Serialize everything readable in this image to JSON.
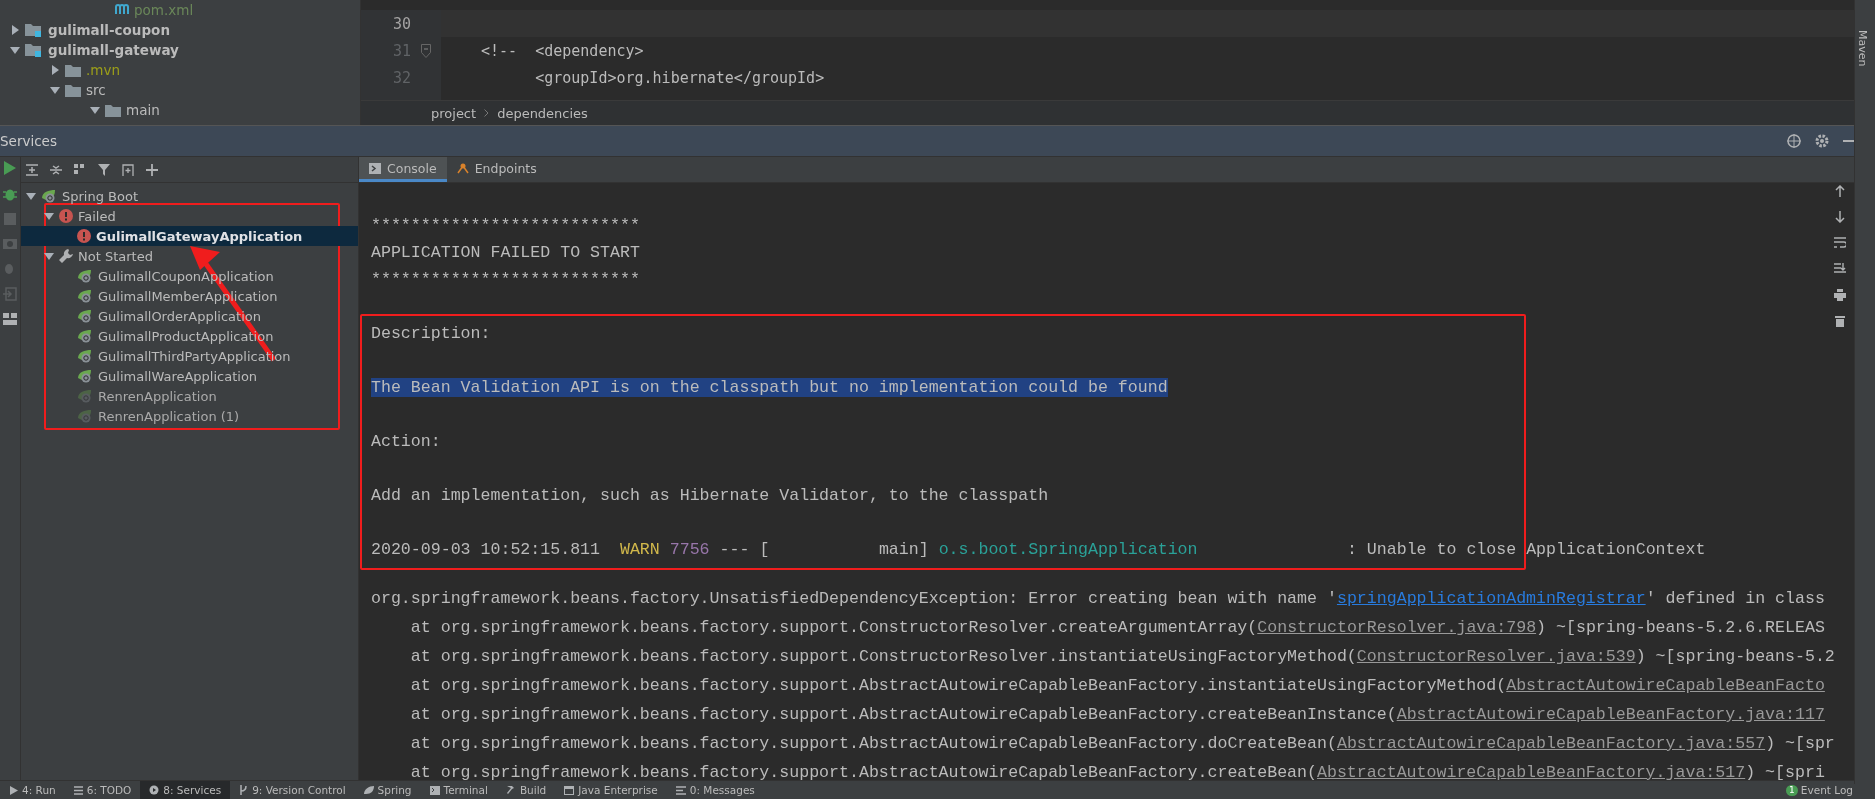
{
  "project_tree": {
    "items": [
      {
        "label": "pom.xml",
        "kind": "maven-file"
      },
      {
        "label": "gulimall-coupon",
        "kind": "module",
        "expanded": false
      },
      {
        "label": "gulimall-gateway",
        "kind": "module",
        "expanded": true,
        "children": [
          {
            "label": ".mvn",
            "kind": "folder",
            "expanded": false,
            "excluded": true
          },
          {
            "label": "src",
            "kind": "folder",
            "expanded": true,
            "excluded": false,
            "children": [
              {
                "label": "main",
                "kind": "folder",
                "expanded": true,
                "excluded": false
              }
            ]
          }
        ]
      }
    ]
  },
  "editor": {
    "lines": [
      {
        "number": "30",
        "current": true
      },
      {
        "number": "31",
        "current": false,
        "fold": true,
        "text": "<!--  <dependency>"
      },
      {
        "number": "32",
        "current": false,
        "text": "      <groupId>org.hibernate</groupId>"
      }
    ],
    "breadcrumbs": [
      "project",
      "dependencies"
    ]
  },
  "services": {
    "title": "Services",
    "tree": [
      {
        "label": "Spring Boot",
        "kind": "spring",
        "expanded": true,
        "selected": false,
        "children": [
          {
            "label": "Failed",
            "kind": "error",
            "expanded": true,
            "selected": false,
            "children": [
              {
                "label": "GulimallGatewayApplication",
                "kind": "error",
                "selected": true
              }
            ]
          },
          {
            "label": "Not Started",
            "kind": "wrench",
            "expanded": true,
            "selected": false,
            "children": [
              {
                "label": "GulimallCouponApplication",
                "kind": "app",
                "disabled": false,
                "selected": false
              },
              {
                "label": "GulimallMemberApplication",
                "kind": "app",
                "disabled": false,
                "selected": false
              },
              {
                "label": "GulimallOrderApplication",
                "kind": "app",
                "disabled": false,
                "selected": false
              },
              {
                "label": "GulimallProductApplication",
                "kind": "app",
                "disabled": false,
                "selected": false
              },
              {
                "label": "GulimallThirdPartyApplication",
                "kind": "app",
                "disabled": false,
                "selected": false
              },
              {
                "label": "GulimallWareApplication",
                "kind": "app",
                "disabled": false,
                "selected": false
              },
              {
                "label": "RenrenApplication",
                "kind": "app",
                "disabled": true,
                "selected": false
              },
              {
                "label": "RenrenApplication (1)",
                "kind": "app",
                "disabled": true,
                "selected": false
              }
            ]
          }
        ]
      }
    ],
    "tabs": [
      {
        "label": "Console",
        "selected": true
      },
      {
        "label": "Endpoints",
        "selected": false
      }
    ],
    "console": [
      {
        "kind": "text",
        "spans": [
          {
            "kind": "plain",
            "text": "***************************"
          }
        ]
      },
      {
        "kind": "text",
        "spans": [
          {
            "kind": "plain",
            "text": "APPLICATION FAILED TO START"
          }
        ]
      },
      {
        "kind": "text",
        "spans": [
          {
            "kind": "plain",
            "text": "***************************"
          }
        ]
      },
      {
        "kind": "blank"
      },
      {
        "kind": "text",
        "spans": [
          {
            "kind": "plain",
            "text": "Description:"
          }
        ]
      },
      {
        "kind": "blank"
      },
      {
        "kind": "text",
        "spans": [
          {
            "kind": "selected",
            "text": "The Bean Validation API is on the classpath but no implementation could be found"
          }
        ]
      },
      {
        "kind": "blank"
      },
      {
        "kind": "text",
        "spans": [
          {
            "kind": "plain",
            "text": "Action:"
          }
        ]
      },
      {
        "kind": "blank"
      },
      {
        "kind": "text",
        "spans": [
          {
            "kind": "plain",
            "text": "Add an implementation, such as Hibernate Validator, to the classpath"
          }
        ]
      },
      {
        "kind": "blank"
      },
      {
        "kind": "text",
        "spans": [
          {
            "kind": "plain",
            "text": "2020-09-03 10:52:15.811  "
          },
          {
            "kind": "warn",
            "text": "WARN"
          },
          {
            "kind": "pid",
            "text": "7756"
          },
          {
            "kind": "plain",
            "text": " --- [           main] "
          },
          {
            "kind": "logger",
            "text": "o.s.boot.SpringApplication"
          },
          {
            "kind": "plain",
            "text": "               : Unable to close ApplicationContext"
          }
        ]
      }
    ],
    "stack": [
      {
        "spans": [
          {
            "kind": "plain",
            "text": "org.springframework.beans.factory.UnsatisfiedDependencyException: Error creating bean with name '"
          },
          {
            "kind": "link",
            "text": "springApplicationAdminRegistrar"
          },
          {
            "kind": "plain",
            "text": "' defined in class"
          }
        ]
      },
      {
        "spans": [
          {
            "kind": "plain",
            "text": "    at org.springframework.beans.factory.support.ConstructorResolver.createArgumentArray("
          },
          {
            "kind": "file",
            "text": "ConstructorResolver.java:798"
          },
          {
            "kind": "plain",
            "text": ") ~[spring-beans-5.2.6.RELEAS"
          }
        ]
      },
      {
        "spans": [
          {
            "kind": "plain",
            "text": "    at org.springframework.beans.factory.support.ConstructorResolver.instantiateUsingFactoryMethod("
          },
          {
            "kind": "file",
            "text": "ConstructorResolver.java:539"
          },
          {
            "kind": "plain",
            "text": ") ~[spring-beans-5.2"
          }
        ]
      },
      {
        "spans": [
          {
            "kind": "plain",
            "text": "    at org.springframework.beans.factory.support.AbstractAutowireCapableBeanFactory.instantiateUsingFactoryMethod("
          },
          {
            "kind": "file",
            "text": "AbstractAutowireCapableBeanFacto"
          }
        ]
      },
      {
        "spans": [
          {
            "kind": "plain",
            "text": "    at org.springframework.beans.factory.support.AbstractAutowireCapableBeanFactory.createBeanInstance("
          },
          {
            "kind": "file",
            "text": "AbstractAutowireCapableBeanFactory.java:117"
          }
        ]
      },
      {
        "spans": [
          {
            "kind": "plain",
            "text": "    at org.springframework.beans.factory.support.AbstractAutowireCapableBeanFactory.doCreateBean("
          },
          {
            "kind": "file",
            "text": "AbstractAutowireCapableBeanFactory.java:557"
          },
          {
            "kind": "plain",
            "text": ") ~[spr"
          }
        ]
      },
      {
        "spans": [
          {
            "kind": "plain",
            "text": "    at org.springframework.beans.factory.support.AbstractAutowireCapableBeanFactory.createBean("
          },
          {
            "kind": "file",
            "text": "AbstractAutowireCapableBeanFactory.java:517"
          },
          {
            "kind": "plain",
            "text": ") ~[spri"
          }
        ]
      }
    ]
  },
  "right_strip": [
    "Maven"
  ],
  "bottom_bar": {
    "tabs": [
      {
        "label": "4: Run",
        "kind": "run",
        "selected": false
      },
      {
        "label": "6: TODO",
        "kind": "todo",
        "selected": false
      },
      {
        "label": "8: Services",
        "kind": "services",
        "selected": true
      },
      {
        "label": "9: Version Control",
        "kind": "vcs",
        "selected": false
      },
      {
        "label": "Spring",
        "kind": "spring",
        "selected": false
      },
      {
        "label": "Terminal",
        "kind": "terminal",
        "selected": false
      },
      {
        "label": "Build",
        "kind": "build",
        "selected": false
      },
      {
        "label": "Java Enterprise",
        "kind": "java",
        "selected": false
      },
      {
        "label": "0: Messages",
        "kind": "messages",
        "selected": false
      }
    ],
    "event_log": {
      "label": "Event Log",
      "badge": "1"
    }
  }
}
